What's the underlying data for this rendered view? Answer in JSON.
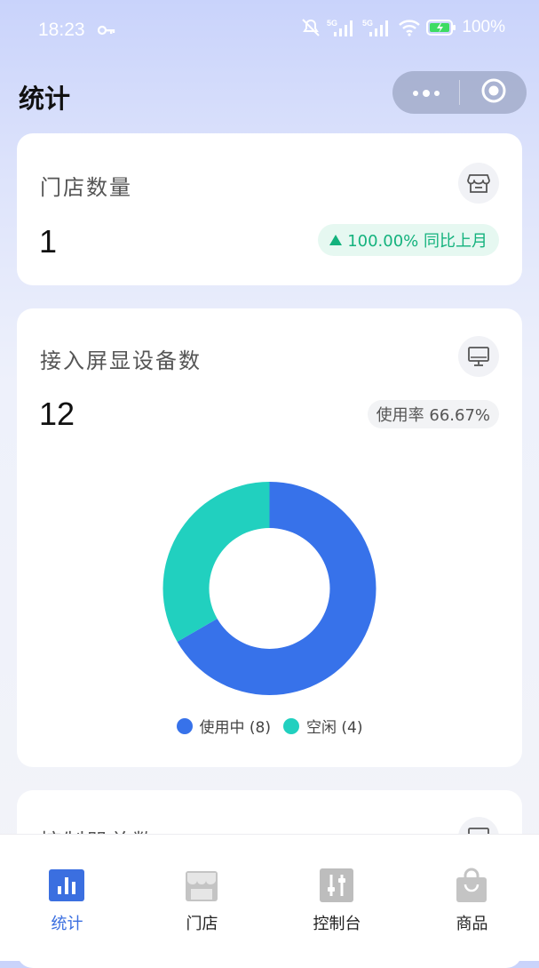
{
  "status_bar": {
    "time": "18:23",
    "icons": [
      "key-icon",
      "mute-icon",
      "signal-5g-icon",
      "signal-5g-icon",
      "wifi-icon",
      "battery-icon"
    ],
    "battery": "100%"
  },
  "page": {
    "title": "统计"
  },
  "cards": {
    "stores": {
      "title": "门店数量",
      "value": "1",
      "icon": "storefront-icon",
      "trend_text": "100.00% 同比上月",
      "trend_direction": "up"
    },
    "screens": {
      "title": "接入屏显设备数",
      "value": "12",
      "icon": "monitor-icon",
      "usage_text": "使用率 66.67%"
    },
    "controllers": {
      "title": "控制器总数",
      "icon": "monitor-icon"
    }
  },
  "chart_data": {
    "type": "pie",
    "donut": true,
    "categories": [
      "使用中",
      "空闲"
    ],
    "values": [
      8,
      4
    ],
    "legend_labels": [
      "使用中 (8)",
      "空闲 (4)"
    ],
    "colors": [
      "#3772ea",
      "#21d0bf"
    ],
    "legend_position": "bottom"
  },
  "tabbar": {
    "tabs": [
      {
        "label": "统计",
        "icon": "bar-chart-icon",
        "active": true
      },
      {
        "label": "门店",
        "icon": "storefront-icon",
        "active": false
      },
      {
        "label": "控制台",
        "icon": "sliders-icon",
        "active": false
      },
      {
        "label": "商品",
        "icon": "shopping-bag-icon",
        "active": false
      }
    ]
  },
  "colors": {
    "accent": "#3b6fe0",
    "success": "#13b27d"
  }
}
